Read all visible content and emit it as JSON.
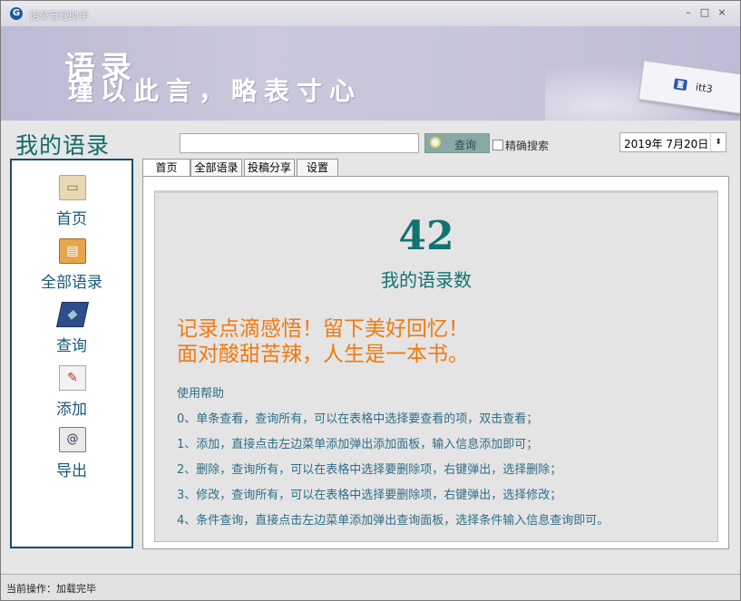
{
  "window": {
    "title": "语录管理助手",
    "controls": {
      "minimize": "–",
      "maximize": "□",
      "close": "×"
    }
  },
  "banner": {
    "line1": "语录",
    "line2": "瑾以此言，略表寸心",
    "card_text": "itt3"
  },
  "page_title": "我的语录",
  "search": {
    "value": "",
    "placeholder": "",
    "query_label": "查询",
    "exact_label": "精确搜索",
    "exact_checked": false
  },
  "date_picker": {
    "value": "2019年 7月20日"
  },
  "sidebar": {
    "items": [
      {
        "label": "首页",
        "icon": "book-open-icon"
      },
      {
        "label": "全部语录",
        "icon": "books-icon"
      },
      {
        "label": "查询",
        "icon": "book-search-icon"
      },
      {
        "label": "添加",
        "icon": "pencil-paper-icon"
      },
      {
        "label": "导出",
        "icon": "address-book-icon"
      }
    ]
  },
  "tabs": [
    {
      "label": "首页",
      "active": true
    },
    {
      "label": "全部语录",
      "active": false
    },
    {
      "label": "投稿分享",
      "active": false
    },
    {
      "label": "设置",
      "active": false
    }
  ],
  "home": {
    "count": "42",
    "count_label": "我的语录数",
    "slogan1": "记录点滴感悟！留下美好回忆！",
    "slogan2": "面对酸甜苦辣，人生是一本书。",
    "help_title": "使用帮助",
    "help": [
      "0、单条查看，查询所有，可以在表格中选择要查看的项，双击查看；",
      "1、添加，直接点击左边菜单添加弹出添加面板，输入信息添加即可；",
      "2、删除，查询所有，可以在表格中选择要删除项，右键弹出，选择删除；",
      "3、修改，查询所有，可以在表格中选择要删除项，右键弹出，选择修改；",
      "4、条件查询，直接点击左边菜单添加弹出查询面板，选择条件输入信息查询即可。"
    ]
  },
  "status": {
    "text": "当前操作：加载完毕"
  },
  "colors": {
    "accent_teal": "#137272",
    "slogan_orange": "#f07a10",
    "help_blue": "#2e6e86",
    "sidebar_border": "#1f4a66"
  }
}
